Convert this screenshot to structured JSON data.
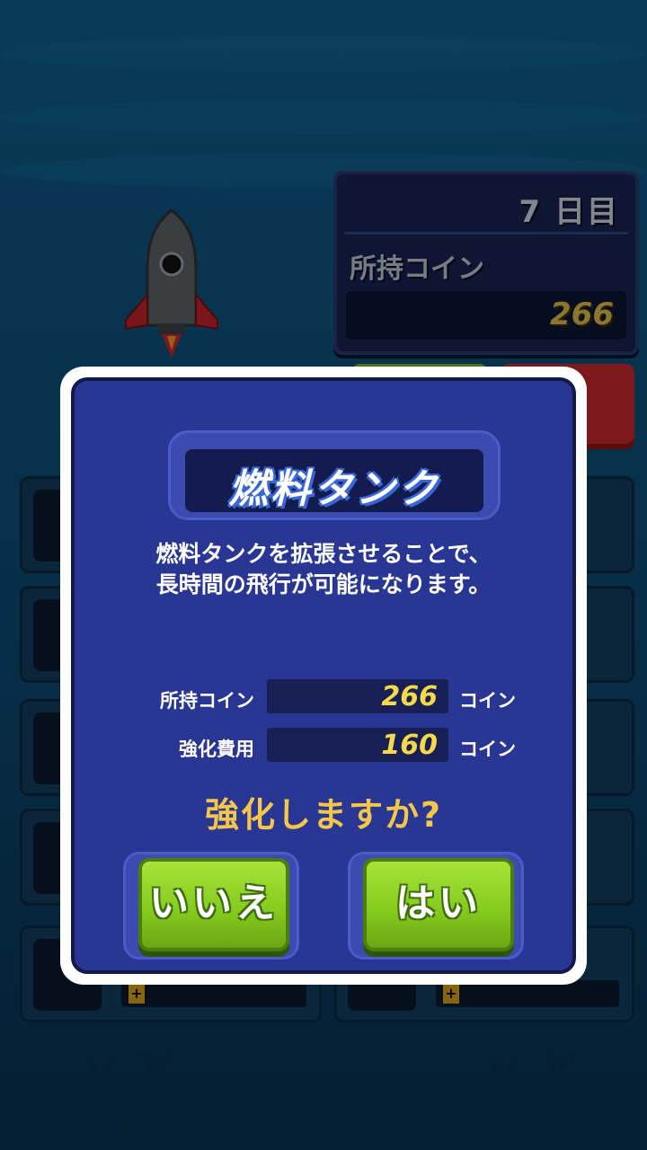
{
  "hud": {
    "day": "7 日目",
    "coins_label": "所持コイン",
    "coins_value": "266"
  },
  "dialog": {
    "title": "燃料タンク",
    "description_line1": "燃料タンクを拡張させることで、",
    "description_line2": "長時間の飛行が可能になります。",
    "owned_label": "所持コイン",
    "owned_value": "266",
    "owned_unit": "コイン",
    "cost_label": "強化費用",
    "cost_value": "160",
    "cost_unit": "コイン",
    "question": "強化しますか?",
    "no_label": "いいえ",
    "yes_label": "はい"
  },
  "upgrade_list": {
    "plus_symbol": "+"
  },
  "colors": {
    "dialog_bg": "#2a3693",
    "accent_yellow": "#f4c64a",
    "button_green": "#86cc1f"
  }
}
